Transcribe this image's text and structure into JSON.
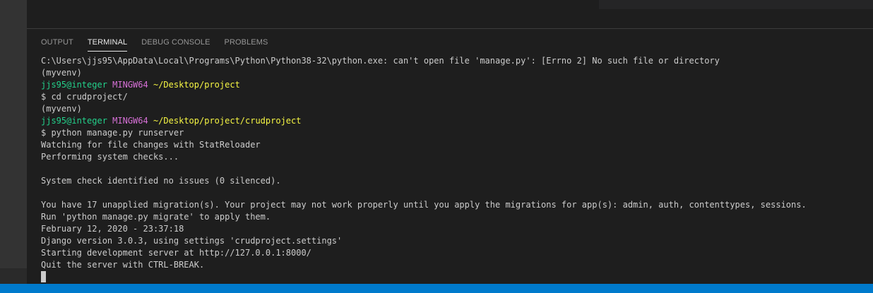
{
  "panel": {
    "tabs": [
      {
        "label": "OUTPUT"
      },
      {
        "label": "TERMINAL"
      },
      {
        "label": "DEBUG CONSOLE"
      },
      {
        "label": "PROBLEMS"
      }
    ],
    "active_tab": "TERMINAL"
  },
  "terminal": {
    "lines": [
      "C:\\Users\\jjs95\\AppData\\Local\\Programs\\Python\\Python38-32\\python.exe: can't open file 'manage.py': [Errno 2] No such file or directory",
      "(myvenv)",
      {
        "user": "jjs95@integer",
        "shell": "MINGW64",
        "path": "~/Desktop/project"
      },
      "$ cd crudproject/",
      "(myvenv)",
      {
        "user": "jjs95@integer",
        "shell": "MINGW64",
        "path": "~/Desktop/project/crudproject"
      },
      "$ python manage.py runserver",
      "Watching for file changes with StatReloader",
      "Performing system checks...",
      "",
      "System check identified no issues (0 silenced).",
      "",
      "You have 17 unapplied migration(s). Your project may not work properly until you apply the migrations for app(s): admin, auth, contenttypes, sessions.",
      "Run 'python manage.py migrate' to apply them.",
      "February 12, 2020 - 23:37:18",
      "Django version 3.0.3, using settings 'crudproject.settings'",
      "Starting development server at http://127.0.0.1:8000/",
      "Quit the server with CTRL-BREAK."
    ]
  },
  "colors": {
    "prompt_user": "#23d18b",
    "prompt_shell": "#d670d6",
    "prompt_path": "#f5f543",
    "status_bar": "#007acc"
  }
}
